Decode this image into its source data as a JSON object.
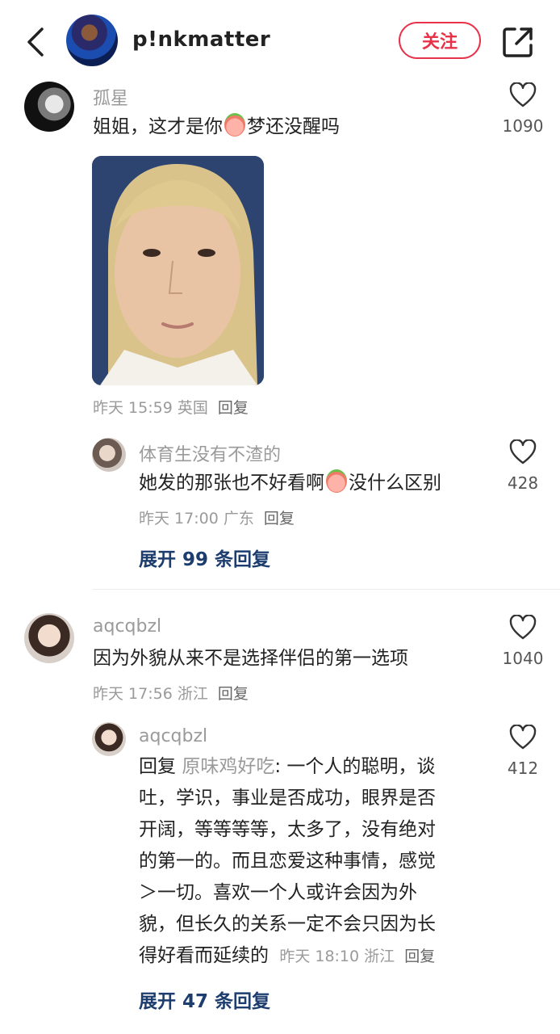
{
  "header": {
    "username": "p!nkmatter",
    "follow_label": "关注"
  },
  "comments": [
    {
      "username": "孤星",
      "text_before": "姐姐，这才是你",
      "text_after": "梦还没醒吗",
      "time": "昨天 15:59",
      "location": "英国",
      "reply_label": "回复",
      "likes": "1090",
      "replies": [
        {
          "username": "体育生没有不渣的",
          "text_before": "她发的那张也不好看啊",
          "text_after": "没什么区别",
          "time": "昨天 17:00",
          "location": "广东",
          "reply_label": "回复",
          "likes": "428"
        }
      ],
      "expand_label": "展开 99 条回复"
    },
    {
      "username": "aqcqbzl",
      "text": "因为外貌从来不是选择伴侣的第一选项",
      "time": "昨天 17:56",
      "location": "浙江",
      "reply_label": "回复",
      "likes": "1040",
      "replies": [
        {
          "username": "aqcqbzl",
          "reply_prefix": "回复",
          "reply_to": "原味鸡好吃",
          "lines": [
            ": 一个人的聪明，谈",
            "吐，学识，事业是否成功，眼界是否",
            "开阔，等等等等，太多了，没有绝对",
            "的第一的。而且恋爱这种事情，感觉",
            "＞一切。喜欢一个人或许会因为外",
            "貌，但长久的关系一定不会只因为长",
            "得好看而延续的"
          ],
          "time": "昨天 18:10",
          "location": "浙江",
          "reply_label": "回复",
          "likes": "412"
        }
      ],
      "expand_label": "展开 47 条回复"
    }
  ]
}
